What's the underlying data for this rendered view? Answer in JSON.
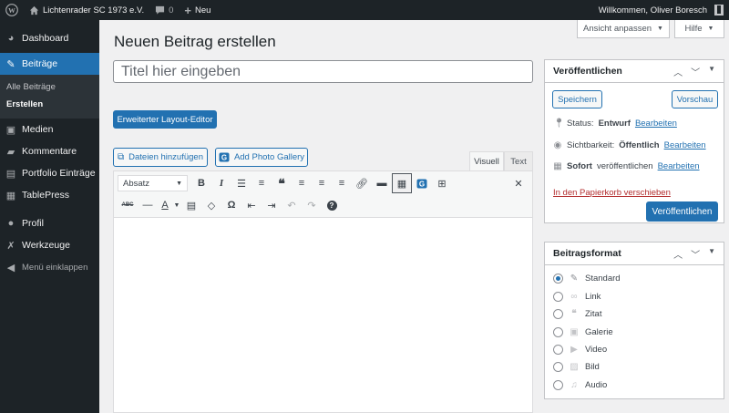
{
  "adminbar": {
    "site_name": "Lichtenrader SC 1973 e.V.",
    "comments_count": "0",
    "new_label": "Neu",
    "welcome": "Willkommen, Oliver Boresch"
  },
  "sidebar": {
    "items": [
      {
        "label": "Dashboard",
        "icon": "dashboard-icon"
      },
      {
        "label": "Beiträge",
        "icon": "pin-icon"
      },
      {
        "label": "Medien",
        "icon": "media-icon"
      },
      {
        "label": "Kommentare",
        "icon": "comment-icon"
      },
      {
        "label": "Portfolio Einträge",
        "icon": "portfolio-icon"
      },
      {
        "label": "TablePress",
        "icon": "table-icon"
      },
      {
        "label": "Profil",
        "icon": "user-icon"
      },
      {
        "label": "Werkzeuge",
        "icon": "wrench-icon"
      }
    ],
    "submenu": [
      "Alle Beiträge",
      "Erstellen"
    ],
    "collapse_label": "Menü einklappen"
  },
  "screen_options": {
    "customize_label": "Ansicht anpassen",
    "help_label": "Hilfe"
  },
  "editor": {
    "page_title": "Neuen Beitrag erstellen",
    "title_placeholder": "Titel hier eingeben",
    "layout_editor_button": "Erweiterter Layout-Editor",
    "add_media_button": "Dateien hinzufügen",
    "add_gallery_button": "Add Photo Gallery",
    "tab_visual": "Visuell",
    "tab_text": "Text",
    "format_select": "Absatz"
  },
  "publish": {
    "title": "Veröffentlichen",
    "save_label": "Speichern",
    "preview_label": "Vorschau",
    "status_label": "Status:",
    "status_value": "Entwurf",
    "visibility_label": "Sichtbarkeit:",
    "visibility_value": "Öffentlich",
    "schedule_value": "Sofort",
    "schedule_label": "veröffentlichen",
    "edit_link": "Bearbeiten",
    "trash_link": "In den Papierkorb verschieben",
    "publish_button": "Veröffentlichen"
  },
  "post_format": {
    "title": "Beitragsformat",
    "options": [
      {
        "label": "Standard",
        "icon": "pin-icon",
        "checked": true
      },
      {
        "label": "Link",
        "icon": "link-icon",
        "checked": false
      },
      {
        "label": "Zitat",
        "icon": "quote-icon",
        "checked": false
      },
      {
        "label": "Galerie",
        "icon": "gallery-icon",
        "checked": false
      },
      {
        "label": "Video",
        "icon": "video-icon",
        "checked": false
      },
      {
        "label": "Bild",
        "icon": "image-icon",
        "checked": false
      },
      {
        "label": "Audio",
        "icon": "audio-icon",
        "checked": false
      }
    ]
  },
  "colors": {
    "accent": "#2271b1",
    "adminbar_bg": "#1d2327",
    "danger": "#b32d2e"
  }
}
